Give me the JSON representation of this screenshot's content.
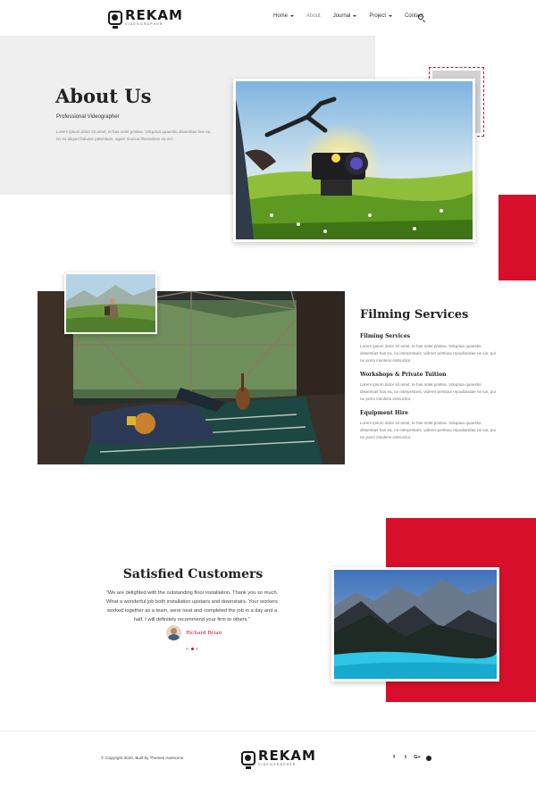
{
  "brand": {
    "name": "REKAM",
    "tagline": "VIDEOGRAPHER"
  },
  "nav": {
    "items": [
      {
        "label": "Home",
        "dropdown": true,
        "active": false
      },
      {
        "label": "About",
        "dropdown": false,
        "active": true
      },
      {
        "label": "Journal",
        "dropdown": true,
        "active": false
      },
      {
        "label": "Project",
        "dropdown": true,
        "active": false
      },
      {
        "label": "Contact",
        "dropdown": false,
        "active": false
      }
    ],
    "search_icon": "search-icon"
  },
  "about": {
    "title": "About Us",
    "subtitle": "Professional Videographer",
    "description": "Lorem ipsum dolor sit amet, te has solet postea. Voluptua quaestio dissentias has ea, no ex aliquid fabulas petentium, agam mucius liberavisse ea vel."
  },
  "services": {
    "title": "Filming Services",
    "items": [
      {
        "heading": "Filming Services",
        "text": "Lorem ipsum dolor sit amet, te has solet postea. Voluptua quaestio dissentias has ea, no interpretaris, viderer pertinax repudiandae ne ius, qui ne porro insolens instructior."
      },
      {
        "heading": "Workshops & Private Tuition",
        "text": "Lorem ipsum dolor sit amet, te has solet postea. Voluptua quaestio dissentias has ea, no interpretaris, viderer pertinax repudiandae ne ius, qui ne porro insolens instructior."
      },
      {
        "heading": "Equipment Hire",
        "text": "Lorem ipsum dolor sit amet, te has solet postea. Voluptua quaestio dissentias has ea, no interpretaris, viderer pertinax repudiandae ne ius, qui ne porro insolens instructior."
      }
    ]
  },
  "customers": {
    "title": "Satisfied Customers",
    "quote": "\"We are delighted with the outstanding floor installation. Thank you so much. What a wonderful job both installation upstairs and downstairs. Your workers worked together as a team, were neat and completed the job in a day and a half. I will definitely recommend your firm to others.\"",
    "author": "Richard Brian",
    "slides": 3,
    "active_slide": 2
  },
  "footer": {
    "copyright": "© Copyright 2020, Built by Themes Awesome",
    "social": [
      {
        "icon": "facebook-icon",
        "glyph": "f"
      },
      {
        "icon": "twitter-icon",
        "glyph": "t"
      },
      {
        "icon": "google-plus-icon",
        "glyph": "G+"
      },
      {
        "icon": "pinterest-icon",
        "glyph": ""
      }
    ]
  },
  "colors": {
    "accent": "#d80f2a",
    "light_bg": "#efefef",
    "text_dark": "#222222"
  }
}
